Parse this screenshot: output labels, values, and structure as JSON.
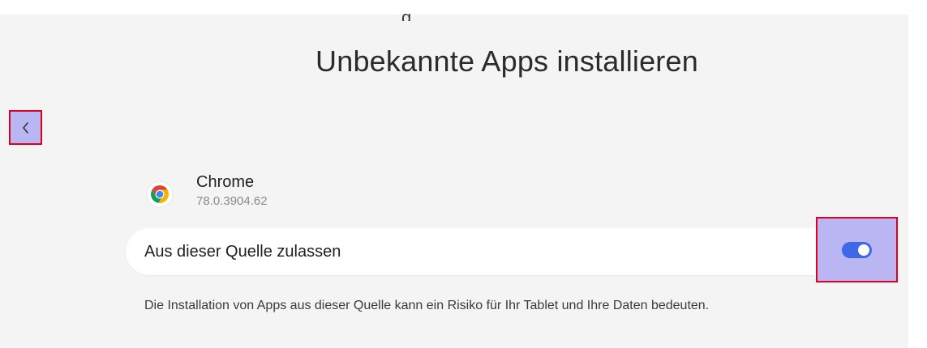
{
  "top_cut_text": "g",
  "header": {
    "title": "Unbekannte Apps installieren"
  },
  "app": {
    "name": "Chrome",
    "version": "78.0.3904.62",
    "icon": "chrome-icon"
  },
  "setting": {
    "label": "Aus dieser Quelle zulassen",
    "enabled": true
  },
  "warning_text": "Die Installation von Apps aus dieser Quelle kann ein Risiko für Ihr Tablet und Ihre Daten bedeuten.",
  "colors": {
    "background": "#f4f4f4",
    "card": "#ffffff",
    "toggle_on": "#3f68e8",
    "highlight_fill": "#b9b6f3",
    "highlight_border": "#e0001b"
  }
}
